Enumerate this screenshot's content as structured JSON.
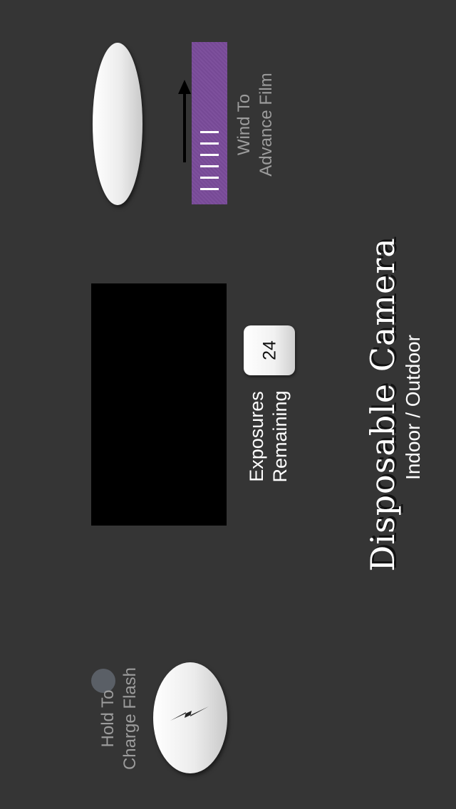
{
  "app": {
    "icons": {
      "shutter": "shutter-button",
      "wind": "film-wind-wheel",
      "arrow": "arrow-up-icon",
      "flash": "lightning-bolt-icon"
    },
    "colors": {
      "background": "#353535",
      "wind_wheel": "#7a4b9a",
      "viewfinder": "#000000",
      "charge_led": "#5a5f66"
    }
  },
  "wind": {
    "label_line1": "Wind To",
    "label_line2": "Advance Film"
  },
  "counter": {
    "value": "24",
    "label_line1": "Exposures",
    "label_line2": "Remaining"
  },
  "brand": {
    "title": "Disposable Camera",
    "subtitle": "Indoor / Outdoor"
  },
  "flash": {
    "label_line1": "Hold To",
    "label_line2": "Charge Flash"
  }
}
